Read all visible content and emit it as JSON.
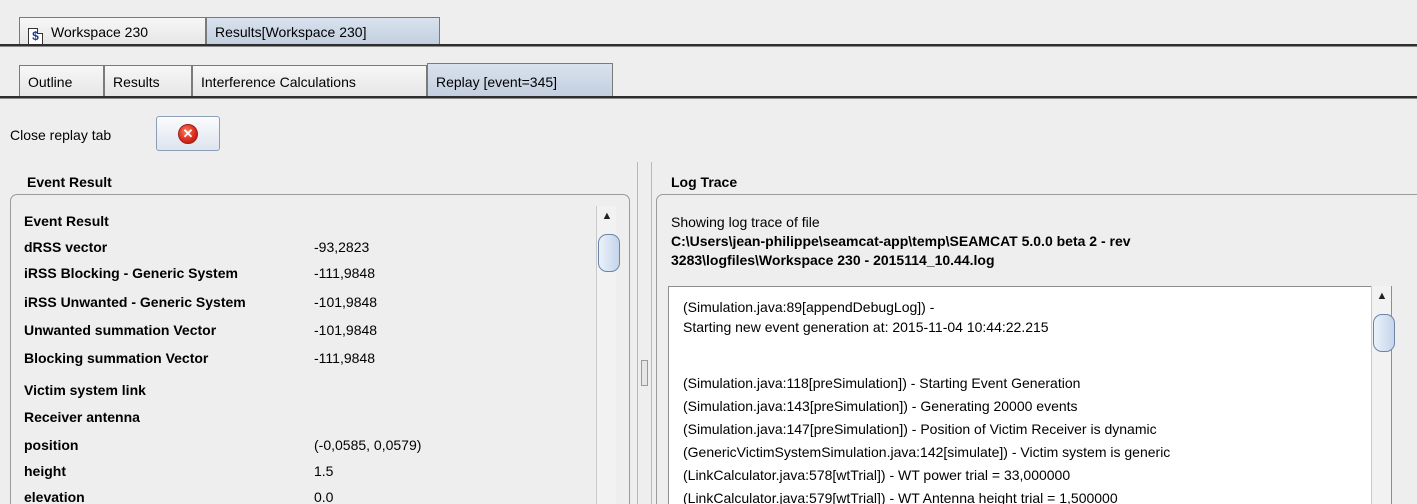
{
  "workspace_tabs": [
    {
      "label": "Workspace 230",
      "icon": "document-dollar-icon",
      "glyph": "$"
    },
    {
      "label": "Results[Workspace 230]"
    }
  ],
  "result_tabs": [
    {
      "label": "Outline"
    },
    {
      "label": "Results"
    },
    {
      "label": "Interference Calculations"
    },
    {
      "label": "Replay [event=345]"
    }
  ],
  "close_replay": {
    "label": "Close replay tab",
    "icon": "close-red-circle-icon",
    "glyph": "✕"
  },
  "event_panel": {
    "title": "Event Result",
    "rows": [
      {
        "label": "Event Result",
        "value": ""
      },
      {
        "label": "dRSS vector",
        "value": "-93,2823"
      },
      {
        "label": "iRSS Blocking - Generic System",
        "value": "-111,9848"
      },
      {
        "label": "iRSS Unwanted - Generic System",
        "value": "-101,9848"
      },
      {
        "label": "Unwanted summation Vector",
        "value": "-101,9848"
      },
      {
        "label": "Blocking summation Vector",
        "value": "-111,9848"
      },
      {
        "label": "Victim system link",
        "value": ""
      },
      {
        "label": "Receiver antenna",
        "value": ""
      },
      {
        "label": "position",
        "value": "(-0,0585, 0,0579)"
      },
      {
        "label": "height",
        "value": "1.5"
      },
      {
        "label": "elevation",
        "value": "0.0"
      }
    ]
  },
  "log_panel": {
    "title": "Log Trace",
    "intro": "Showing log trace of file",
    "path_line1": "C:\\Users\\jean-philippe\\seamcat-app\\temp\\SEAMCAT 5.0.0 beta 2 - rev",
    "path_line2": "3283\\logfiles\\Workspace 230 - 2015114_10.44.log",
    "lines": [
      "(Simulation.java:89[appendDebugLog]) -",
      "Starting new event generation at: 2015-11-04 10:44:22.215",
      "",
      "(Simulation.java:118[preSimulation]) - Starting Event Generation",
      "(Simulation.java:143[preSimulation]) - Generating 20000 events",
      "(Simulation.java:147[preSimulation]) - Position of Victim Receiver is dynamic",
      "(GenericVictimSystemSimulation.java:142[simulate]) - Victim system is generic",
      "(LinkCalculator.java:578[wtTrial]) - WT power trial = 33,000000",
      "(LinkCalculator.java:579[wtTrial]) - WT Antenna height trial = 1,500000"
    ]
  },
  "colors": {
    "selected_tab": "#c3cfdf",
    "panel_background": "#eeeeee",
    "log_background": "#ffffff",
    "close_icon": "#d9261b"
  }
}
